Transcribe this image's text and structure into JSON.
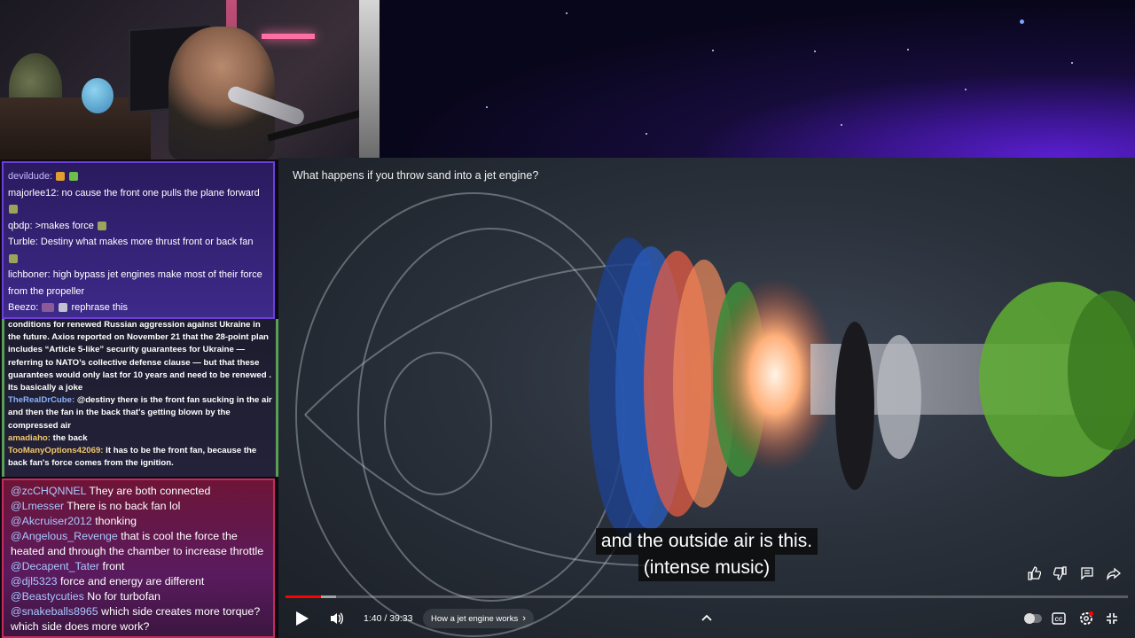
{
  "video": {
    "title": "What happens if you throw sand into a jet engine?",
    "captions": [
      "and the outside air is this.",
      "(intense music)"
    ],
    "time_current": "1:40",
    "time_total": "39:33",
    "time_display": "1:40 / 39:33",
    "chapter": "How a jet engine works",
    "progress_fraction": 0.042
  },
  "chat_top": [
    {
      "user": "devildude:",
      "text": "",
      "badges": [
        "#e0a030",
        "#6cc04a"
      ]
    },
    {
      "user": "majorlee12:",
      "text": " no cause the front one pulls the plane forward"
    },
    {
      "user": "qbdp:",
      "text": " >makes force"
    },
    {
      "user": "Turble:",
      "text": " Destiny what makes more thrust front or back fan"
    },
    {
      "user": "lichboner:",
      "text": " high bypass jet engines make most of their force from the propeller"
    },
    {
      "user": "Beezo:",
      "text": " rephrase this"
    }
  ],
  "chat_mid": [
    {
      "user": "",
      "text": "conditions for renewed Russian aggression against Ukraine in the future. Axios reported on November 21 that the 28-point plan includes “Article 5-like” security guarantees for Ukraine — referring to NATO’s collective defense clause — but that these guarantees would only last for 10 years and need to be renewed . Its basically a joke"
    },
    {
      "user": "TheRealDrCube:",
      "text": " @destiny there is the front fan sucking in the air and then the fan in the back that's getting blown by the compressed air"
    },
    {
      "user": "amadiaho:",
      "text": " the back"
    },
    {
      "user": "TooManyOptions42069:",
      "text": " It has to be the front fan, because the back fan's force comes from the ignition."
    }
  ],
  "chat_bottom": [
    {
      "user": "@zcCHQNNEL",
      "text": " They are both connected"
    },
    {
      "user": "@Lmesser",
      "text": " There is no back fan lol"
    },
    {
      "user": "@Akcruiser2012",
      "text": " thonking"
    },
    {
      "user": "@Angelous_Revenge",
      "text": " that is cool the force the heated and through the chamber to increase throttle"
    },
    {
      "user": "@Decapent_Tater",
      "text": " front"
    },
    {
      "user": "@djl5323",
      "text": " force and energy are different"
    },
    {
      "user": "@Beastycuties",
      "text": " No for turbofan"
    },
    {
      "user": "@snakeballs8965",
      "text": " which side creates more torque? which side does more work?"
    }
  ],
  "icons": {
    "play": "play-icon",
    "volume": "volume-icon",
    "chevron": "chevron-right-icon",
    "up": "chevron-up-icon",
    "like": "thumbs-up-icon",
    "dislike": "thumbs-down-icon",
    "comment": "comment-icon",
    "share": "share-icon",
    "autoplay": "autoplay-toggle-icon",
    "cc": "captions-icon",
    "settings": "settings-icon",
    "exit_fullscreen": "exit-fullscreen-icon"
  },
  "colors": {
    "progress": "#ff0000",
    "chat_top_border": "#6e3fd6",
    "chat_bottom_border": "#c72b5a"
  }
}
